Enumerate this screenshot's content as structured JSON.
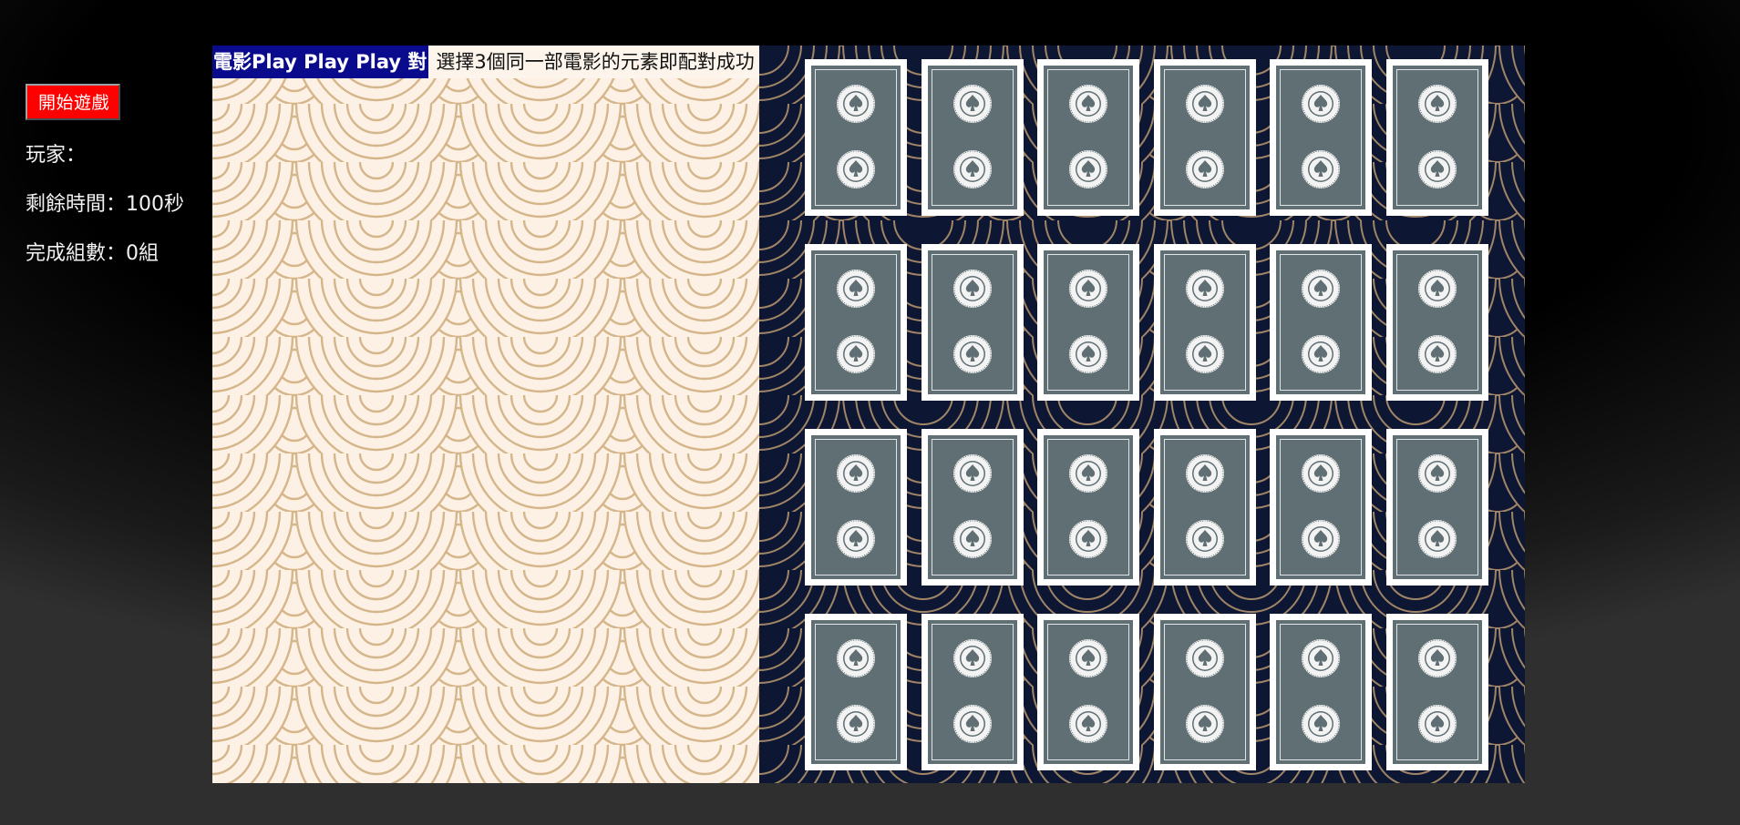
{
  "sidebar": {
    "start_button": "開始遊戲",
    "player": "玩家：",
    "time_remaining": "剩餘時間：100秒",
    "completed_sets": "完成組數：0組"
  },
  "header": {
    "title": "電影Play Play Play 對",
    "instruction": "選擇3個同一部電影的元素即配對成功"
  },
  "board": {
    "rows": 4,
    "columns": 6,
    "card_state": "face-down",
    "card_back_icon": "spade-seal-icon"
  },
  "colors": {
    "start_button": "#ff0000",
    "title_bar": "#0a0a8c",
    "left_panel_bg": "#fdf0e4",
    "left_panel_pattern": "#d4b68a",
    "right_panel_bg": "#0d1733",
    "right_panel_pattern": "#a08466",
    "card_back": "#5f6f73"
  }
}
